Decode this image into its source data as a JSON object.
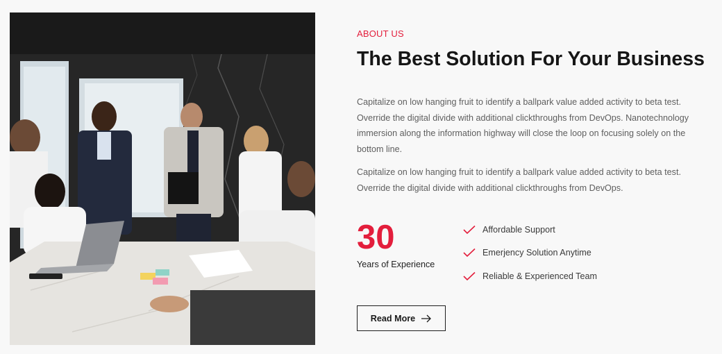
{
  "about": {
    "eyebrow": "ABOUT US",
    "title": "The Best Solution For Your Business",
    "paragraphs": [
      "Capitalize on low hanging fruit to identify a ballpark value added activity to beta test. Override the digital divide with additional clickthroughs from DevOps. Nanotechnology immersion along the information highway will close the loop on focusing solely on the bottom line.",
      "Capitalize on low hanging fruit to identify a ballpark value added activity to beta test. Override the digital divide with additional clickthroughs from DevOps."
    ]
  },
  "stat": {
    "number": "30",
    "label": "Years of Experience"
  },
  "features": [
    {
      "label": "Affordable Support",
      "icon": "check-icon"
    },
    {
      "label": "Emerjency Solution Anytime",
      "icon": "check-icon"
    },
    {
      "label": "Reliable & Experienced Team",
      "icon": "check-icon"
    }
  ],
  "cta": {
    "label": "Read More",
    "icon": "arrow-right-icon"
  },
  "colors": {
    "accent": "#e31e3c",
    "heading": "#161616",
    "body": "#5e5e5e",
    "background": "#f8f8f8"
  }
}
